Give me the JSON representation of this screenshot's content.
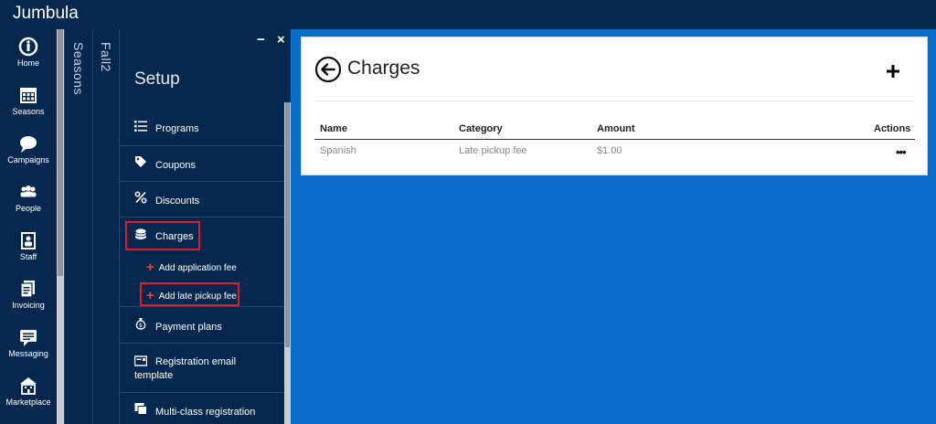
{
  "app": {
    "title": "Jumbula"
  },
  "nav": [
    {
      "label": "Home",
      "icon": "home-icon"
    },
    {
      "label": "Seasons",
      "icon": "calendar-icon"
    },
    {
      "label": "Campaigns",
      "icon": "chat-bubble-icon"
    },
    {
      "label": "People",
      "icon": "people-icon"
    },
    {
      "label": "Staff",
      "icon": "staff-badge-icon"
    },
    {
      "label": "Invoicing",
      "icon": "invoice-icon"
    },
    {
      "label": "Messaging",
      "icon": "message-icon"
    },
    {
      "label": "Marketplace",
      "icon": "marketplace-icon"
    }
  ],
  "panels": {
    "seasons": "Seasons",
    "season_name": "Fall2"
  },
  "setup": {
    "title": "Setup",
    "minimize": "−",
    "close": "×",
    "items": [
      {
        "label": "Programs",
        "icon": "list-icon"
      },
      {
        "label": "Coupons",
        "icon": "tag-icon"
      },
      {
        "label": "Discounts",
        "icon": "percent-icon"
      },
      {
        "label": "Charges",
        "icon": "coins-icon"
      },
      {
        "label": "Payment plans",
        "icon": "money-bag-icon"
      },
      {
        "label": "Registration email template",
        "icon": "email-template-icon"
      },
      {
        "label": "Multi-class registration",
        "icon": "multi-class-icon"
      }
    ],
    "sub_items": [
      {
        "label": "Add application fee"
      },
      {
        "label": "Add late pickup fee"
      }
    ]
  },
  "charges": {
    "title": "Charges",
    "columns": [
      "Name",
      "Category",
      "Amount",
      "Actions"
    ],
    "rows": [
      {
        "name": "Spanish",
        "category": "Late pickup fee",
        "amount": "$1.00",
        "actions": "•••"
      }
    ]
  },
  "colors": {
    "topbar": "#06284f",
    "content_background": "#0a6cc9",
    "highlight_box": "#e01b2a",
    "plus_accent": "#e8404a"
  }
}
